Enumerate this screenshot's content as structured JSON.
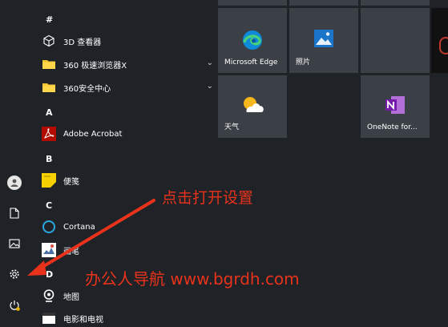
{
  "letters": {
    "hash": "#",
    "a": "A",
    "b": "B",
    "c": "C",
    "d": "D"
  },
  "apps": [
    {
      "label": "3D 查看器",
      "icon": "cube-icon"
    },
    {
      "label": "360 极速浏览器X",
      "icon": "folder-icon",
      "expand": "⌄"
    },
    {
      "label": "360安全中心",
      "icon": "folder-icon",
      "expand": "⌄"
    },
    {
      "label": "Adobe Acrobat",
      "icon": "acrobat-icon"
    },
    {
      "label": "便笺",
      "icon": "sticky-notes-icon"
    },
    {
      "label": "Cortana",
      "icon": "cortana-icon"
    },
    {
      "label": "画笔",
      "icon": "paint-icon"
    },
    {
      "label": "地图",
      "icon": "maps-icon"
    },
    {
      "label": "电影和电视",
      "icon": "movies-icon"
    }
  ],
  "tiles": {
    "edge": {
      "label": "Microsoft Edge",
      "icon": "edge-icon"
    },
    "photos": {
      "label": "照片",
      "icon": "photos-icon"
    },
    "weather": {
      "label": "天气",
      "icon": "weather-icon"
    },
    "onenote": {
      "label": "OneNote for...",
      "icon": "onenote-icon"
    }
  },
  "rail": [
    "user-avatar-icon",
    "documents-icon",
    "pictures-icon",
    "settings-icon",
    "power-icon"
  ],
  "annotations": {
    "hint": "点击打开设置",
    "watermark": "办公人导航 www.bgrdh.com"
  },
  "colors": {
    "background": "#1f2327",
    "tile": "#3b4046",
    "annotation": "#e8321b"
  }
}
